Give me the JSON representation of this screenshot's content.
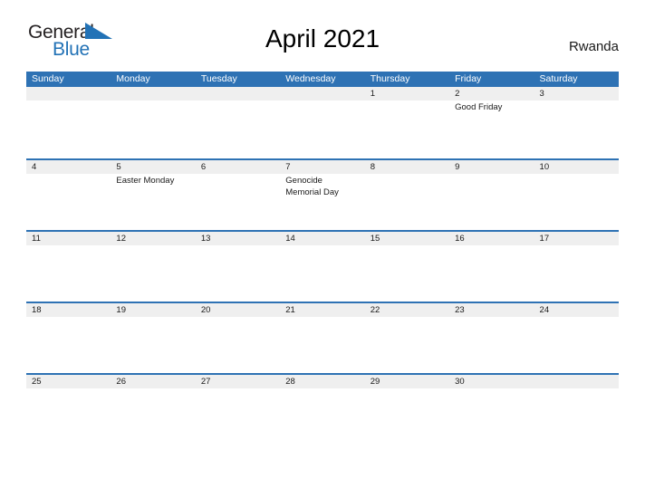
{
  "brand": {
    "name_part1": "General",
    "name_part2": "Blue",
    "flag_icon": "blue-flag-triangle",
    "color_dark": "#231f20",
    "color_blue": "#2272b6"
  },
  "header": {
    "title": "April 2021",
    "country": "Rwanda"
  },
  "theme": {
    "header_blue": "#2e72b4",
    "daynum_band": "#efefef",
    "text": "#1a1a1a",
    "page_bg": "#ffffff"
  },
  "calendar": {
    "month": "April",
    "year": "2021",
    "weekdays": [
      "Sunday",
      "Monday",
      "Tuesday",
      "Wednesday",
      "Thursday",
      "Friday",
      "Saturday"
    ],
    "weeks": [
      {
        "days": [
          {
            "num": "",
            "events": []
          },
          {
            "num": "",
            "events": []
          },
          {
            "num": "",
            "events": []
          },
          {
            "num": "",
            "events": []
          },
          {
            "num": "1",
            "events": []
          },
          {
            "num": "2",
            "events": [
              "Good Friday"
            ]
          },
          {
            "num": "3",
            "events": []
          }
        ]
      },
      {
        "days": [
          {
            "num": "4",
            "events": []
          },
          {
            "num": "5",
            "events": [
              "Easter Monday"
            ]
          },
          {
            "num": "6",
            "events": []
          },
          {
            "num": "7",
            "events": [
              "Genocide",
              "Memorial Day"
            ]
          },
          {
            "num": "8",
            "events": []
          },
          {
            "num": "9",
            "events": []
          },
          {
            "num": "10",
            "events": []
          }
        ]
      },
      {
        "days": [
          {
            "num": "11",
            "events": []
          },
          {
            "num": "12",
            "events": []
          },
          {
            "num": "13",
            "events": []
          },
          {
            "num": "14",
            "events": []
          },
          {
            "num": "15",
            "events": []
          },
          {
            "num": "16",
            "events": []
          },
          {
            "num": "17",
            "events": []
          }
        ]
      },
      {
        "days": [
          {
            "num": "18",
            "events": []
          },
          {
            "num": "19",
            "events": []
          },
          {
            "num": "20",
            "events": []
          },
          {
            "num": "21",
            "events": []
          },
          {
            "num": "22",
            "events": []
          },
          {
            "num": "23",
            "events": []
          },
          {
            "num": "24",
            "events": []
          }
        ]
      },
      {
        "days": [
          {
            "num": "25",
            "events": []
          },
          {
            "num": "26",
            "events": []
          },
          {
            "num": "27",
            "events": []
          },
          {
            "num": "28",
            "events": []
          },
          {
            "num": "29",
            "events": []
          },
          {
            "num": "30",
            "events": []
          },
          {
            "num": "",
            "events": []
          }
        ]
      }
    ]
  }
}
